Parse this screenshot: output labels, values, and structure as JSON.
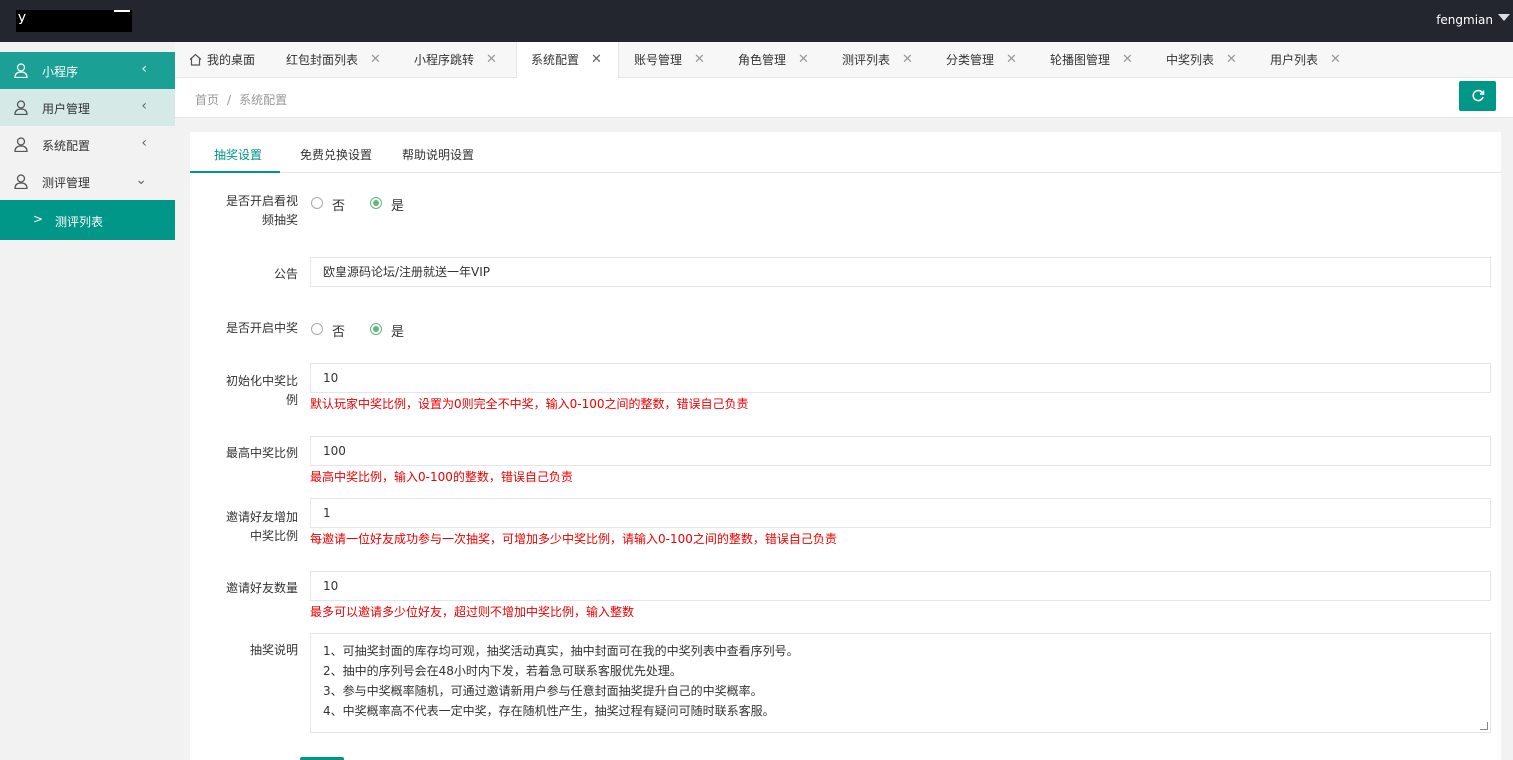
{
  "header": {
    "logo_char": "У",
    "username": "fengmian"
  },
  "sidebar": {
    "items": [
      {
        "label": "小程序",
        "icon": "user-icon",
        "arrow": "<",
        "state": "active"
      },
      {
        "label": "用户管理",
        "icon": "user-icon",
        "arrow": "<",
        "state": "hover"
      },
      {
        "label": "系统配置",
        "icon": "user-icon",
        "arrow": "<",
        "state": "normal"
      },
      {
        "label": "测评管理",
        "icon": "user-icon",
        "arrow": "v",
        "state": "normal"
      }
    ],
    "subitem": {
      "label": "测评列表",
      "arrow": ">"
    }
  },
  "tabs": [
    {
      "label": "我的桌面",
      "icon": "home-icon"
    },
    {
      "label": "红包封面列表"
    },
    {
      "label": "小程序跳转"
    },
    {
      "label": "系统配置",
      "current": true
    },
    {
      "label": "账号管理"
    },
    {
      "label": "角色管理"
    },
    {
      "label": "测评列表"
    },
    {
      "label": "分类管理"
    },
    {
      "label": "轮播图管理"
    },
    {
      "label": "中奖列表"
    },
    {
      "label": "用户列表"
    }
  ],
  "breadcrumb": {
    "home": "首页",
    "separator": "/",
    "current": "系统配置"
  },
  "subtabs": [
    "抽奖设置",
    "免费兑换设置",
    "帮助说明设置"
  ],
  "form": {
    "video_lottery": {
      "label_line1": "是否开启看视",
      "label_line2": "频抽奖",
      "opt_no": "否",
      "opt_yes": "是",
      "selected": "是"
    },
    "notice": {
      "label": "公告",
      "value": "欧皇源码论坛/注册就送一年VIP"
    },
    "win_enabled": {
      "label": "是否开启中奖",
      "opt_no": "否",
      "opt_yes": "是",
      "selected": "是"
    },
    "init_rate": {
      "label_line1": "初始化中奖比",
      "label_line2": "例",
      "value": "10",
      "hint": "默认玩家中奖比例，设置为0则完全不中奖，输入0-100之间的整数，错误自己负责"
    },
    "max_rate": {
      "label": "最高中奖比例",
      "value": "100",
      "hint": "最高中奖比例，输入0-100的整数，错误自己负责"
    },
    "invite_rate": {
      "label_line1": "邀请好友增加",
      "label_line2": "中奖比例",
      "value": "1",
      "hint": "每邀请一位好友成功参与一次抽奖，可增加多少中奖比例，请输入0-100之间的整数，错误自己负责"
    },
    "invite_count": {
      "label": "邀请好友数量",
      "value": "10",
      "hint": "最多可以邀请多少位好友，超过则不增加中奖比例，输入整数"
    },
    "description": {
      "label": "抽奖说明",
      "lines": [
        "1、可抽奖封面的库存均可观，抽奖活动真实，抽中封面可在我的中奖列表中查看序列号。",
        "2、抽中的序列号会在48小时内下发，若着急可联系客服优先处理。",
        "3、参与中奖概率随机，可通过邀请新用户参与任意封面抽奖提升自己的中奖概率。",
        "4、中奖概率高不代表一定中奖，存在随机性产生，抽奖过程有疑问可随时联系客服。"
      ]
    }
  },
  "colors": {
    "topbar": "#23262e",
    "accent": "#009688",
    "sidebar_active": "#1aa094",
    "hint": "#e00000",
    "radio_on": "#5fb878"
  }
}
